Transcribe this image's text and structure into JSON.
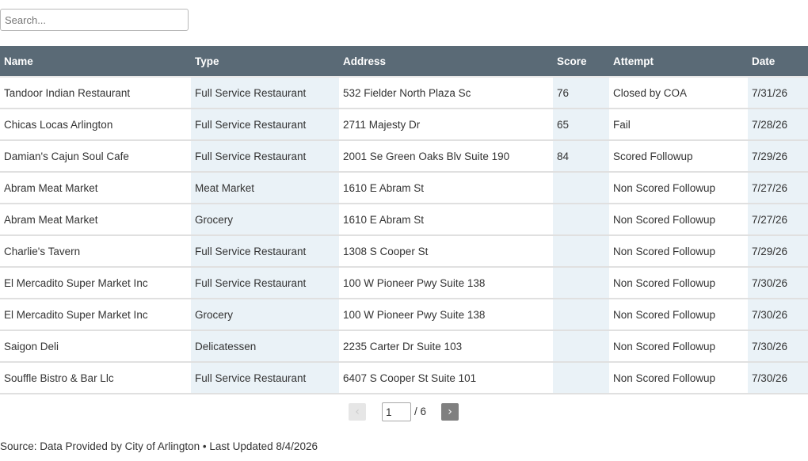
{
  "search": {
    "placeholder": "Search...",
    "value": ""
  },
  "table": {
    "headers": [
      "Name",
      "Type",
      "Address",
      "Score",
      "Attempt",
      "Date"
    ],
    "rows": [
      [
        "Tandoor Indian Restaurant",
        "Full Service Restaurant",
        "532 Fielder North Plaza Sc",
        "76",
        "Closed by COA",
        "7/31/26"
      ],
      [
        "Chicas Locas Arlington",
        "Full Service Restaurant",
        "2711 Majesty Dr",
        "65",
        "Fail",
        "7/28/26"
      ],
      [
        "Damian's Cajun Soul Cafe",
        "Full Service Restaurant",
        "2001 Se Green Oaks Blv Suite 190",
        "84",
        "Scored Followup",
        "7/29/26"
      ],
      [
        "Abram Meat Market",
        "Meat Market",
        "1610 E Abram St",
        "",
        "Non Scored Followup",
        "7/27/26"
      ],
      [
        "Abram Meat Market",
        "Grocery",
        "1610 E Abram St",
        "",
        "Non Scored Followup",
        "7/27/26"
      ],
      [
        "Charlie's Tavern",
        "Full Service Restaurant",
        "1308 S Cooper St",
        "",
        "Non Scored Followup",
        "7/29/26"
      ],
      [
        "El Mercadito Super Market Inc",
        "Full Service Restaurant",
        "100 W Pioneer Pwy Suite 138",
        "",
        "Non Scored Followup",
        "7/30/26"
      ],
      [
        "El Mercadito Super Market Inc",
        "Grocery",
        "100 W Pioneer Pwy Suite 138",
        "",
        "Non Scored Followup",
        "7/30/26"
      ],
      [
        "Saigon Deli",
        "Delicatessen",
        "2235 Carter Dr Suite 103",
        "",
        "Non Scored Followup",
        "7/30/26"
      ],
      [
        "Souffle Bistro & Bar Llc",
        "Full Service Restaurant",
        "6407 S Cooper St Suite 101",
        "",
        "Non Scored Followup",
        "7/30/26"
      ]
    ]
  },
  "pagination": {
    "prev_icon": "chevron-left-icon",
    "prev_label": "‹",
    "current_page": "1",
    "total_label": "/ 6",
    "next_icon": "chevron-right-icon",
    "next_label": "›"
  },
  "footer": {
    "source": "Source: Data Provided by City of Arlington • Last Updated 8/4/2026"
  },
  "colors": {
    "header_bg": "#5a6a76",
    "shaded_column": "#eaf2f7",
    "next_button": "#808080"
  }
}
